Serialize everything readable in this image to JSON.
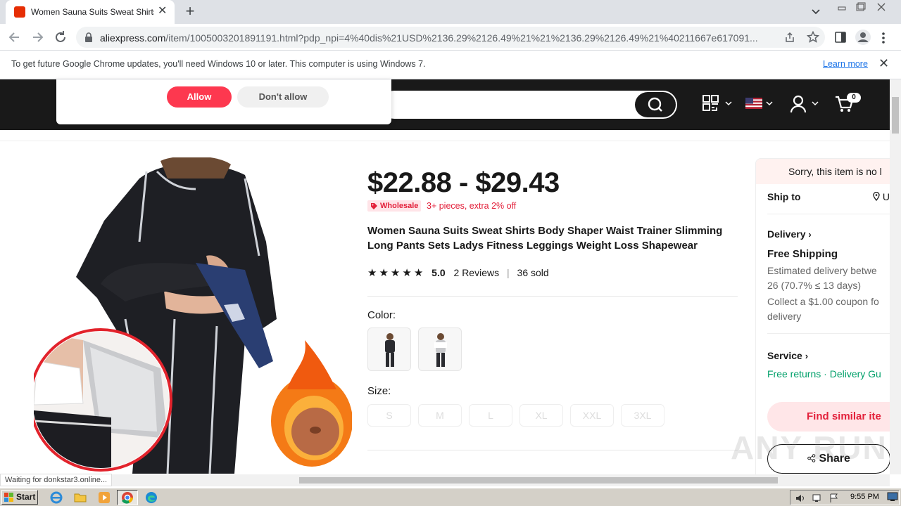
{
  "browser": {
    "tab_title": "Women Sauna Suits Sweat Shirts Bo",
    "url_domain": "aliexpress.com",
    "url_path": "/item/1005003201891191.html?pdp_npi=4%40dis%21USD%2136.29%2126.49%21%21%2136.29%2126.49%21%40211667e617091...",
    "infobar_message": "To get future Google Chrome updates, you'll need Windows 10 or later. This computer is using Windows 7.",
    "infobar_link": "Learn more"
  },
  "popup": {
    "allow_label": "Allow",
    "deny_label": "Don't allow"
  },
  "header": {
    "cart_count": "0"
  },
  "product": {
    "price": "$22.88 - $29.43",
    "wholesale_tag": "Wholesale",
    "wholesale_text": "3+ pieces, extra 2% off",
    "title": "Women Sauna Suits Sweat Shirts Body Shaper Waist Trainer Slimming Long Pants Sets Ladys Fitness Leggings Weight Loss Shapewear",
    "rating_value": "5.0",
    "stars": 5,
    "reviews": "2 Reviews",
    "sold": "36 sold",
    "color_label": "Color:",
    "size_label": "Size:",
    "sizes": [
      "S",
      "M",
      "L",
      "XL",
      "XXL",
      "3XL"
    ]
  },
  "side_panel": {
    "sorry": "Sorry, this item is no l",
    "ship_to": "Ship to",
    "ship_to_value": "U",
    "delivery": "Delivery",
    "free_shipping": "Free Shipping",
    "estimated_1": "Estimated delivery betwe",
    "estimated_2": "26 (70.7% ≤ 13 days)",
    "coupon_1": "Collect a $1.00 coupon fo",
    "coupon_2": "delivery",
    "service": "Service",
    "service_text_1": "Free returns",
    "service_text_2": "Delivery Gu",
    "find_similar": "Find similar ite",
    "share": "Share"
  },
  "status_bar": "Waiting for donkstar3.online...",
  "taskbar": {
    "start": "Start",
    "clock": "9:55 PM"
  },
  "watermark": "ANY RUN",
  "colors": {
    "accent_red": "#fd384f",
    "header_dark": "#191919",
    "green": "#00a06a"
  }
}
